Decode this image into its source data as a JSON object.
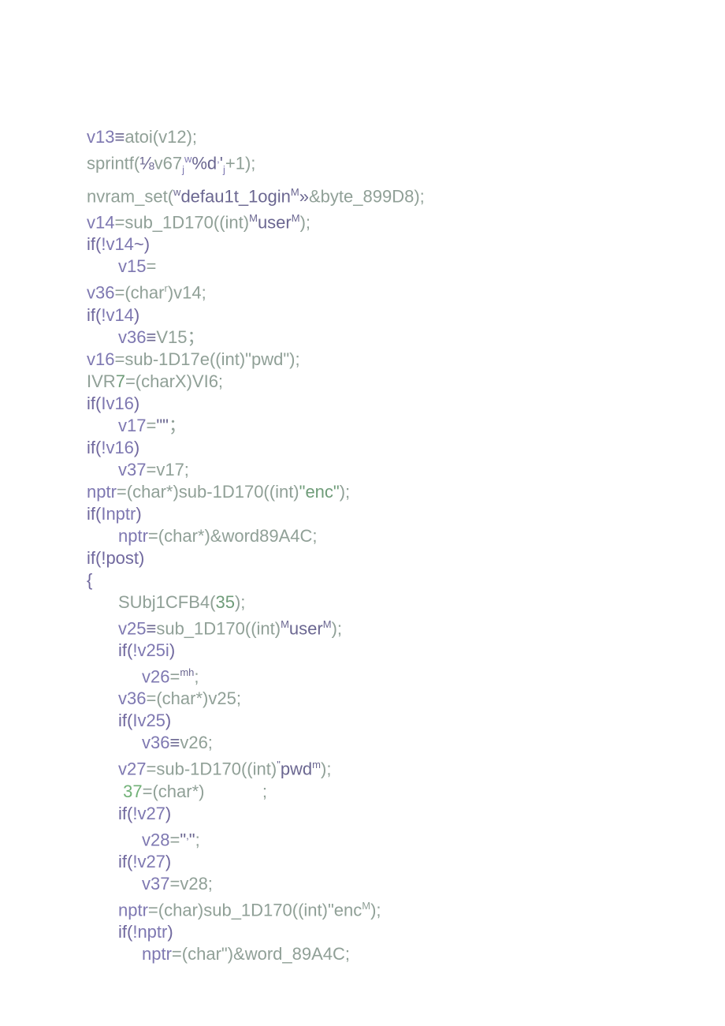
{
  "lines": [
    {
      "cls": "",
      "spans": [
        {
          "t": "v13",
          "c": "pv"
        },
        {
          "t": "≡",
          "c": "ps"
        },
        {
          "t": "atoi(v12);",
          "c": "ca"
        }
      ]
    },
    {
      "cls": "",
      "spans": [
        {
          "t": "sprintf(",
          "c": "ca"
        },
        {
          "t": "⅛",
          "c": "ps"
        },
        {
          "t": "v67",
          "c": "ca"
        },
        {
          "t": "j",
          "c": "pv",
          "sub": true
        },
        {
          "t": "w",
          "c": "pv",
          "sup": true
        },
        {
          "t": "%d",
          "c": "ps"
        },
        {
          "t": ",",
          "c": "pv",
          "sup": true
        },
        {
          "t": "'",
          "c": "ps"
        },
        {
          "t": "j",
          "c": "pv",
          "sub": true
        },
        {
          "t": "+1);",
          "c": "ca"
        }
      ]
    },
    {
      "cls": "",
      "spans": [
        {
          "t": "nvram_set(",
          "c": "ca"
        },
        {
          "t": "w",
          "c": "ps",
          "sup": true
        },
        {
          "t": "defau1t_1ogin",
          "c": "ps"
        },
        {
          "t": "M",
          "c": "ps",
          "sup": true
        },
        {
          "t": "»",
          "c": "ps"
        },
        {
          "t": "&byte_899D8);",
          "c": "ca"
        }
      ]
    },
    {
      "cls": "",
      "spans": [
        {
          "t": "v14",
          "c": "pv"
        },
        {
          "t": "=sub_1D170((int)",
          "c": "ca"
        },
        {
          "t": "M",
          "c": "ps",
          "sup": true
        },
        {
          "t": "user",
          "c": "ps"
        },
        {
          "t": "M",
          "c": "ps",
          "sup": true
        },
        {
          "t": ");",
          "c": "ca"
        }
      ]
    },
    {
      "cls": "",
      "spans": [
        {
          "t": "if(",
          "c": "ke"
        },
        {
          "t": "!v14",
          "c": "pv"
        },
        {
          "t": "~)",
          "c": "ke"
        }
      ]
    },
    {
      "cls": "indent1",
      "spans": [
        {
          "t": "v15",
          "c": "pv"
        },
        {
          "t": "=",
          "c": "ca"
        }
      ]
    },
    {
      "cls": "",
      "spans": [
        {
          "t": "v36",
          "c": "pv"
        },
        {
          "t": "=(char",
          "c": "ca"
        },
        {
          "t": "r",
          "c": "ca",
          "sup": true
        },
        {
          "t": ")v14;",
          "c": "ca"
        }
      ]
    },
    {
      "cls": "",
      "spans": [
        {
          "t": "if(",
          "c": "ke"
        },
        {
          "t": "!v14",
          "c": "pv"
        },
        {
          "t": ")",
          "c": "ke"
        }
      ]
    },
    {
      "cls": "indent1",
      "spans": [
        {
          "t": "v36",
          "c": "pv"
        },
        {
          "t": "≡",
          "c": "ps"
        },
        {
          "t": "V15",
          "c": "ca"
        },
        {
          "t": "；",
          "c": "ca"
        }
      ]
    },
    {
      "cls": "",
      "spans": [
        {
          "t": "v16",
          "c": "pv"
        },
        {
          "t": "=sub",
          "c": "ca"
        },
        {
          "t": "-",
          "c": "ca"
        },
        {
          "t": "1D17e((int)\"pwd\");",
          "c": "ca"
        }
      ]
    },
    {
      "cls": "",
      "spans": [
        {
          "t": "IVR",
          "c": "ca"
        },
        {
          "t": "7",
          "c": "st"
        },
        {
          "t": "=(charX)VI6;",
          "c": "ca"
        }
      ]
    },
    {
      "cls": "",
      "spans": [
        {
          "t": "if(",
          "c": "ke"
        },
        {
          "t": "Iv16",
          "c": "pv"
        },
        {
          "t": ")",
          "c": "ke"
        }
      ]
    },
    {
      "cls": "indent1",
      "spans": [
        {
          "t": "v17",
          "c": "pv"
        },
        {
          "t": "=",
          "c": "ca"
        },
        {
          "t": "\"\"",
          "c": "ps"
        },
        {
          "t": "；",
          "c": "ca"
        }
      ]
    },
    {
      "cls": "",
      "spans": [
        {
          "t": "if(",
          "c": "ke"
        },
        {
          "t": "!v16",
          "c": "pv"
        },
        {
          "t": ")",
          "c": "ke"
        }
      ]
    },
    {
      "cls": "indent1",
      "spans": [
        {
          "t": "v37",
          "c": "pv"
        },
        {
          "t": "=v17;",
          "c": "ca"
        }
      ]
    },
    {
      "cls": "",
      "spans": [
        {
          "t": "nptr",
          "c": "pv"
        },
        {
          "t": "=(char*)sub",
          "c": "ca"
        },
        {
          "t": "-",
          "c": "ca"
        },
        {
          "t": "1D170((int)",
          "c": "ca"
        },
        {
          "t": "\"enc\"",
          "c": "st"
        },
        {
          "t": ");",
          "c": "ca"
        }
      ]
    },
    {
      "cls": "",
      "spans": [
        {
          "t": "if(",
          "c": "ke"
        },
        {
          "t": "Inptr",
          "c": "pv"
        },
        {
          "t": ")",
          "c": "ke"
        }
      ]
    },
    {
      "cls": "indent1",
      "spans": [
        {
          "t": "nptr",
          "c": "pv"
        },
        {
          "t": "=(char*)&word89A4C;",
          "c": "ca"
        }
      ]
    },
    {
      "cls": "",
      "spans": [
        {
          "t": "if(!post)",
          "c": "ke"
        }
      ]
    },
    {
      "cls": "",
      "spans": [
        {
          "t": "{",
          "c": "ke"
        }
      ]
    },
    {
      "cls": "indent1",
      "spans": [
        {
          "t": "SUbj1CFB4(",
          "c": "ca"
        },
        {
          "t": "35",
          "c": "st"
        },
        {
          "t": ");",
          "c": "ca"
        }
      ]
    },
    {
      "cls": "indent1",
      "spans": [
        {
          "t": "v25",
          "c": "pv"
        },
        {
          "t": "≡",
          "c": "ps"
        },
        {
          "t": "sub_1D170((int)",
          "c": "ca"
        },
        {
          "t": "M",
          "c": "ps",
          "sup": true
        },
        {
          "t": "user",
          "c": "ps"
        },
        {
          "t": "M",
          "c": "ps",
          "sup": true
        },
        {
          "t": ");",
          "c": "ca"
        }
      ]
    },
    {
      "cls": "indent1",
      "spans": [
        {
          "t": "if(",
          "c": "ke"
        },
        {
          "t": "!v25i",
          "c": "pv"
        },
        {
          "t": ")",
          "c": "ke"
        }
      ]
    },
    {
      "cls": "indent2",
      "spans": [
        {
          "t": "v26",
          "c": "pv"
        },
        {
          "t": "=",
          "c": "ca"
        },
        {
          "t": "mh",
          "c": "ps",
          "sup": true
        },
        {
          "t": ";",
          "c": "ca"
        }
      ]
    },
    {
      "cls": "indent1",
      "spans": [
        {
          "t": "v36",
          "c": "pv"
        },
        {
          "t": "=(char*)v25;",
          "c": "ca"
        }
      ]
    },
    {
      "cls": "indent1",
      "spans": [
        {
          "t": "if(",
          "c": "ke"
        },
        {
          "t": "Iv25",
          "c": "pv"
        },
        {
          "t": ")",
          "c": "ke"
        }
      ]
    },
    {
      "cls": "indent2",
      "spans": [
        {
          "t": "v36",
          "c": "pv"
        },
        {
          "t": "≡",
          "c": "ps"
        },
        {
          "t": "v26;",
          "c": "ca"
        }
      ]
    },
    {
      "cls": "indent1",
      "spans": [
        {
          "t": "v27",
          "c": "pv"
        },
        {
          "t": "=sub",
          "c": "ca"
        },
        {
          "t": "-",
          "c": "ca"
        },
        {
          "t": "1D170((int)",
          "c": "ca"
        },
        {
          "t": "\"",
          "c": "ps",
          "sup": true
        },
        {
          "t": "pwd",
          "c": "ps"
        },
        {
          "t": "m",
          "c": "ps",
          "sup": true
        },
        {
          "t": ");",
          "c": "ca"
        }
      ]
    },
    {
      "cls": "indent1",
      "spans": [
        {
          "t": " ",
          "c": "ca"
        },
        {
          "t": "37",
          "c": "sp"
        },
        {
          "t": "=(char*)",
          "c": "ca"
        },
        {
          "t": "            ",
          "c": "ca"
        },
        {
          "t": ";",
          "c": "ca"
        }
      ]
    },
    {
      "cls": "indent1",
      "spans": [
        {
          "t": "if(",
          "c": "ke"
        },
        {
          "t": "!v27",
          "c": "pv"
        },
        {
          "t": ")",
          "c": "ke"
        }
      ]
    },
    {
      "cls": "indent2",
      "spans": [
        {
          "t": "v28",
          "c": "pv"
        },
        {
          "t": "=",
          "c": "ca"
        },
        {
          "t": "\"",
          "c": "ps"
        },
        {
          "t": ",",
          "c": "ps",
          "sup": true
        },
        {
          "t": "\"",
          "c": "ps"
        },
        {
          "t": ";",
          "c": "ca"
        }
      ]
    },
    {
      "cls": "indent1",
      "spans": [
        {
          "t": "if(",
          "c": "ke"
        },
        {
          "t": "!v27",
          "c": "pv"
        },
        {
          "t": ")",
          "c": "ke"
        }
      ]
    },
    {
      "cls": "indent2",
      "spans": [
        {
          "t": "v37",
          "c": "pv"
        },
        {
          "t": "=v28;",
          "c": "ca"
        }
      ]
    },
    {
      "cls": "indent1",
      "spans": [
        {
          "t": "nptr",
          "c": "pv"
        },
        {
          "t": "=(char)sub_1D170((int)\"enc",
          "c": "ca"
        },
        {
          "t": "M",
          "c": "ca",
          "sup": true
        },
        {
          "t": ");",
          "c": "ca"
        }
      ]
    },
    {
      "cls": "indent1",
      "spans": [
        {
          "t": "if(",
          "c": "ke"
        },
        {
          "t": "!nptr",
          "c": "pv"
        },
        {
          "t": ")",
          "c": "ke"
        }
      ]
    },
    {
      "cls": "indent2",
      "spans": [
        {
          "t": "nptr",
          "c": "pv"
        },
        {
          "t": "=(char",
          "c": "ca"
        },
        {
          "t": "\"",
          "c": "ca"
        },
        {
          "t": ")&word_89A4C;",
          "c": "ca"
        }
      ]
    }
  ]
}
